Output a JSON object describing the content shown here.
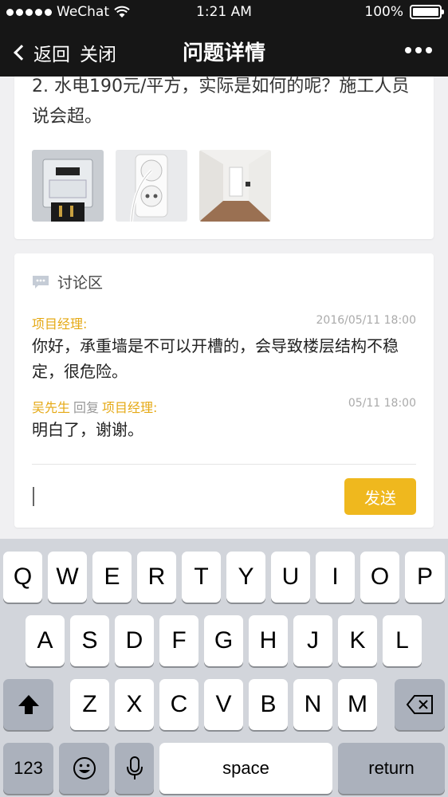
{
  "status": {
    "carrier": "WeChat",
    "time": "1:21 AM",
    "battery": "100%"
  },
  "nav": {
    "back_label": "返回",
    "close_label": "关闭",
    "title": "问题详情"
  },
  "issue": {
    "text": "2. 水电190元/平方，实际是如何的呢？施工人员说会超。",
    "photos": [
      {
        "name": "photo-electric-meter"
      },
      {
        "name": "photo-wall-socket"
      },
      {
        "name": "photo-room"
      }
    ]
  },
  "discussion": {
    "header": "讨论区",
    "comments": [
      {
        "author": "项目经理:",
        "reply_word": "",
        "reply_to": "",
        "time": "2016/05/11 18:00",
        "body": "你好，承重墙是不可以开槽的，会导致楼层结构不稳定，很危险。"
      },
      {
        "author": "吴先生",
        "reply_word": "回复",
        "reply_to": "项目经理:",
        "time": "05/11 18:00",
        "body": "明白了，谢谢。"
      }
    ],
    "input_value": "",
    "send_label": "发送"
  },
  "keyboard": {
    "row1": [
      "Q",
      "W",
      "E",
      "R",
      "T",
      "Y",
      "U",
      "I",
      "O",
      "P"
    ],
    "row2": [
      "A",
      "S",
      "D",
      "F",
      "G",
      "H",
      "J",
      "K",
      "L"
    ],
    "row3": [
      "Z",
      "X",
      "C",
      "V",
      "B",
      "N",
      "M"
    ],
    "numbers_label": "123",
    "space_label": "space",
    "return_label": "return"
  },
  "colors": {
    "accent": "#efb81e",
    "author": "#e5a915",
    "nav_bg": "#161616"
  }
}
